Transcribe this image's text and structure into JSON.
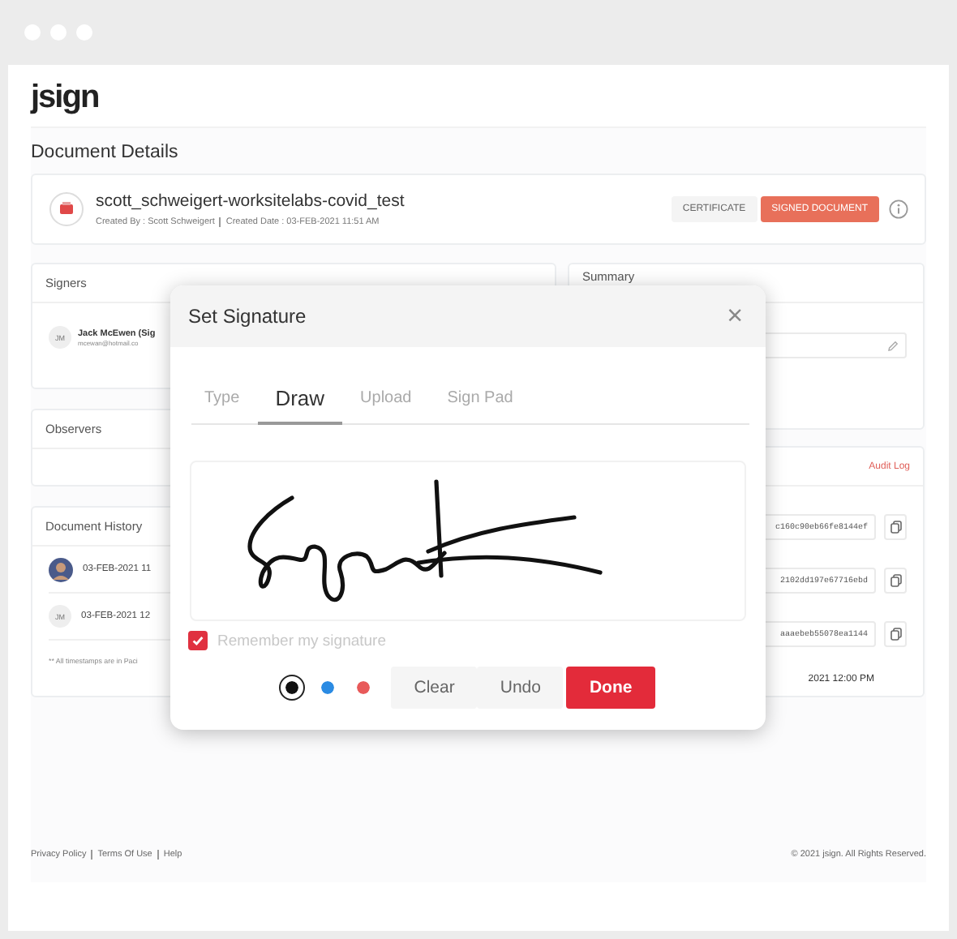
{
  "logo": "jsign",
  "page_title": "Document Details",
  "document": {
    "name": "scott_schweigert-worksitelabs-covid_test",
    "created_by": "Created By : Scott Schweigert",
    "created_date": "Created Date : 03-FEB-2021 11:51 AM",
    "buttons": [
      {
        "label": "CERTIFICATE",
        "kind": "secondary"
      },
      {
        "label": "SIGNED DOCUMENT",
        "kind": "primary"
      }
    ]
  },
  "signers": {
    "title": "Signers",
    "items": [
      {
        "initials": "JM",
        "name": "Jack McEwen (Sig",
        "email": "mcewan@hotmail.co"
      }
    ]
  },
  "observers": {
    "title": "Observers"
  },
  "history": {
    "title": "Document History",
    "items": [
      {
        "kind": "photo",
        "time": "03-FEB-2021 11"
      },
      {
        "kind": "initials",
        "initials": "JM",
        "time": "03-FEB-2021 12"
      }
    ],
    "note": "** All timestamps are in Paci"
  },
  "summary": {
    "title": "Summary"
  },
  "audit": {
    "link": "Audit Log",
    "hashes": [
      "c160c90eb66fe8144ef",
      "2102dd197e67716ebd",
      "aaaebeb55078ea1144"
    ],
    "timestamp": "2021 12:00 PM"
  },
  "footer": {
    "links": [
      "Privacy Policy",
      "Terms Of Use",
      "Help"
    ],
    "copyright": "© 2021 jsign. All Rights Reserved."
  },
  "modal": {
    "title": "Set Signature",
    "close": "×",
    "tabs": [
      {
        "label": "Type",
        "selected": false
      },
      {
        "label": "Draw",
        "selected": true
      },
      {
        "label": "Upload",
        "selected": false
      },
      {
        "label": "Sign Pad",
        "selected": false
      }
    ],
    "remember": {
      "label": "Remember my signature",
      "checked": true
    },
    "pens": [
      {
        "color": "#111111",
        "selected": true
      },
      {
        "color": "#2b8be3",
        "selected": false
      },
      {
        "color": "#e85a5a",
        "selected": false
      }
    ],
    "buttons": [
      {
        "label": "Clear",
        "kind": "secondary"
      },
      {
        "label": "Undo",
        "kind": "secondary"
      },
      {
        "label": "Done",
        "kind": "primary"
      }
    ]
  }
}
